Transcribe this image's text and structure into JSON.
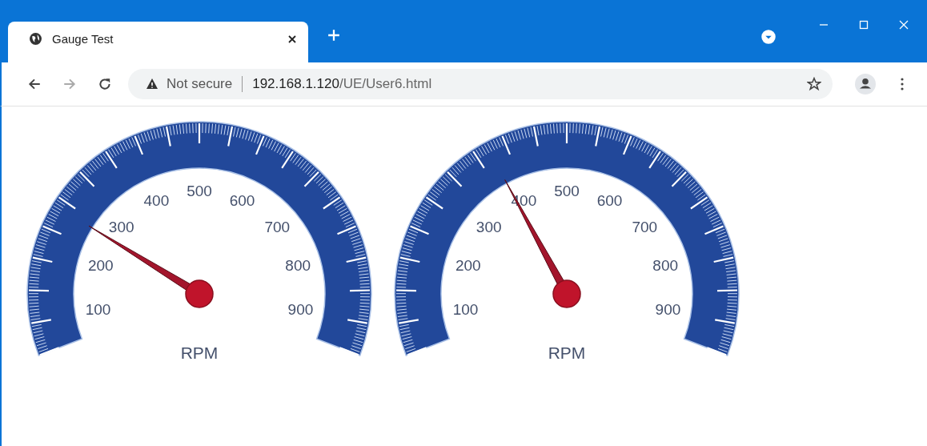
{
  "tab": {
    "title": "Gauge Test",
    "selected": true
  },
  "address_bar": {
    "security": "Not secure",
    "host": "192.168.1.120",
    "path": "/UE/User6.html"
  },
  "gauges": [
    {
      "labels": [
        "100",
        "200",
        "300",
        "400",
        "500",
        "600",
        "700",
        "800",
        "900"
      ],
      "unit": "RPM",
      "level": 0.264
    },
    {
      "labels": [
        "100",
        "200",
        "300",
        "400",
        "500",
        "600",
        "700",
        "800",
        "900"
      ],
      "unit": "RPM",
      "level": 0.385
    }
  ]
}
